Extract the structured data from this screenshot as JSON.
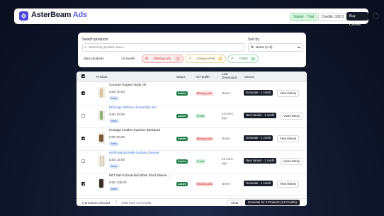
{
  "app": {
    "brand": "AsterBeam",
    "brand_suffix": "Ads",
    "plan_badge": "Starter · Trial",
    "credits": "Credits: 102.0",
    "buy_credits": "Buy Credits",
    "help_icon": "question-circle-icon"
  },
  "filters": {
    "search_label": "Search products",
    "search_placeholder": "Search by product name...",
    "sort_label": "Sort by",
    "sort_value": "Name (A-Z)",
    "sync_label": "Sync products",
    "ad_health_label": "Ad Health",
    "chips": [
      {
        "label": "Missing Ads",
        "count": "7",
        "icon": "x-circle-icon"
      },
      {
        "label": "Fatigue Risk",
        "count": "0",
        "icon": "warning-icon"
      },
      {
        "label": "Fresh",
        "count": "3",
        "icon": "check-circle-icon"
      }
    ]
  },
  "table": {
    "columns": [
      "Product",
      "Status",
      "Ad Health",
      "Last Generated",
      "Actions"
    ],
    "rows": [
      {
        "name": "Coconut Organic Body Oil",
        "price": "USD 20.00",
        "tag": "New",
        "status": "Active",
        "health": "Missing Ads",
        "last": "Never",
        "action": "Generate · 1 credit",
        "history": "View History",
        "checked": true,
        "link": false
      },
      {
        "name": "Ethology Wellness Essentials Set",
        "price": "USD 30.00",
        "tag": "New",
        "status": "Active",
        "health": "Fresh",
        "last": "45 mins ago",
        "action": "New Variant · 1 credit",
        "history": "View History",
        "checked": false,
        "link": true
      },
      {
        "name": "Heritage Leather Explorer Backpack",
        "price": "USD 50.00",
        "tag": "New",
        "status": "Active",
        "health": "Missing Ads",
        "last": "Never",
        "action": "Generate · 1 credit",
        "history": "View History",
        "checked": true,
        "link": false
      },
      {
        "name": "Knifit Natural Multi-Surface Cleaner",
        "price": "USD 15.00",
        "tag": "New",
        "status": "Active",
        "health": "Fresh",
        "last": "45 mins ago",
        "action": "New Variant · 1 credit",
        "history": "View History",
        "checked": false,
        "link": true
      },
      {
        "name": "NET Men's Essential White Short Sleeve ...",
        "price": "USD 100.00",
        "tag": "New",
        "status": "Active",
        "health": "Missing Ads",
        "last": "Never",
        "action": "Generate · 1 credit",
        "history": "View History",
        "checked": true,
        "link": false
      }
    ]
  },
  "footer": {
    "selected": "0 products selected",
    "separator": "|",
    "total": "Total cost: 3.0 credits",
    "clear": "Clear",
    "generate_all": "Generate for 3 Products (3.0 Credits)"
  },
  "colors": {
    "brand": "#4b47d8",
    "active": "#1d7a45",
    "missing": "#b62a2a",
    "dark_button": "#1b1f2b"
  }
}
